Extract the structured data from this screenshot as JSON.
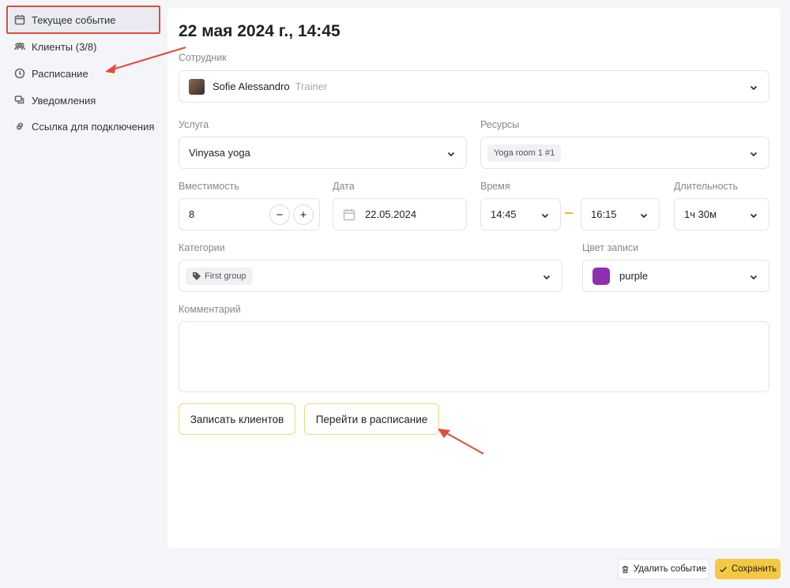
{
  "sidebar": {
    "items": [
      {
        "label": "Текущее событие",
        "icon": "calendar-icon",
        "active": true
      },
      {
        "label": "Клиенты (3/8)",
        "icon": "users-icon"
      },
      {
        "label": "Расписание",
        "icon": "clock-icon"
      },
      {
        "label": "Уведомления",
        "icon": "chat-icon"
      },
      {
        "label": "Ссылка для подключения",
        "icon": "link-icon"
      }
    ]
  },
  "event": {
    "title": "22 мая 2024 г., 14:45",
    "employee_label": "Сотрудник",
    "employee_name": "Sofie Alessandro",
    "employee_role": "Trainer",
    "service_label": "Услуга",
    "service_value": "Vinyasa yoga",
    "resources_label": "Ресурсы",
    "resource_chip": "Yoga room 1 #1",
    "capacity_label": "Вместимость",
    "capacity_value": "8",
    "minus": "−",
    "plus": "+",
    "date_label": "Дата",
    "date_value": "22.05.2024",
    "time_label": "Время",
    "time_start": "14:45",
    "time_end": "16:15",
    "duration_label": "Длительность",
    "duration_value": "1ч 30м",
    "categories_label": "Категории",
    "category_chip": "First group",
    "color_label": "Цвет записи",
    "color_value": "purple",
    "color_hex": "#8e2fb1",
    "comment_label": "Комментарий",
    "enroll_button": "Записать клиентов",
    "schedule_button": "Перейти в расписание"
  },
  "footer": {
    "delete_button": "Удалить событие",
    "save_button": "Сохранить"
  },
  "colors": {
    "accent": "#f5c842",
    "annotation": "#e54a3b"
  }
}
